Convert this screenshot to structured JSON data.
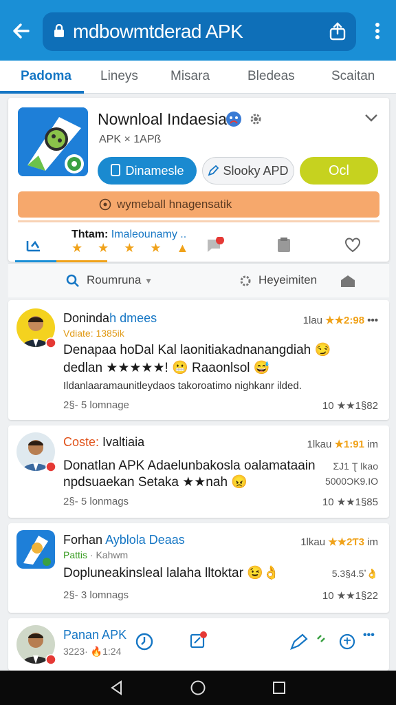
{
  "topbar": {
    "url": "mdbowmtderad APK",
    "colors": {
      "bar": "#1a8fd6",
      "url_box": "#0e6fb8"
    }
  },
  "tabs": [
    {
      "label": "Padoma",
      "active": true
    },
    {
      "label": "Lineys",
      "active": false
    },
    {
      "label": "Misara",
      "active": false
    },
    {
      "label": "Bledeas",
      "active": false
    },
    {
      "label": "Scaitan",
      "active": false
    }
  ],
  "app": {
    "name": "Nownloal Indaesia",
    "subtitle": "APK × 1APß",
    "buttons": {
      "primary": "Dinamesle",
      "outline": "Slooky APD",
      "lime": "Ocl"
    },
    "banner": "wymeball hnagensatik",
    "row_title_bold": "Thtam:",
    "row_title_rest": "Imaleounamy ..",
    "row_stars": "★★★★▲"
  },
  "filter": {
    "left_label": "Roumruna",
    "right_label": "Heyeimiten"
  },
  "reviews": [
    {
      "name_a": "Doninda",
      "name_b": "h dmees",
      "sub": "Vdiate: 1385ik",
      "time": "1lau",
      "score": "★★2:98",
      "line1": "Denapaa hoDal Kal laonitiakadnanangdiah 😏",
      "line2": "dedlan ★★★★★! 😬 Raaonlsol 😅",
      "line3": "Ildanlaaramaunitleydaos takoroatimo nighkanr ilded.",
      "footer": "2§- 5 lomnage",
      "rating": "10 ★★1§82"
    },
    {
      "name_a": "Coste:",
      "name_b": "Ivaltiaia",
      "time": "1lkau",
      "score": "★1:91",
      "score_unit": "im",
      "line1": "Donatlan APK Adaelunbakosla oalamataain",
      "line2": "npdsuaekan Setaka ★★nah 😠",
      "side1": "ƩJ1 Ʈ lkao",
      "side2": "5000ƆK9.IO",
      "footer": "2§- 5 lonmags",
      "rating": "10 ★★1§85"
    },
    {
      "name_a": "Forhan",
      "name_b": "Ayblola Deaas",
      "sub_g": "Pattis",
      "sub_rest": "· Kahwm",
      "time": "1lkau",
      "score": "★★2Ƭ3",
      "score_unit": "im",
      "line1": "Dopluneakinsleal lalaha lltoktar 😉👌",
      "side1": "5.3§4.5ʼ👌",
      "footer": "2§- 3 lomnags",
      "rating": "10 ★★1§22"
    },
    {
      "name": "Panan APK",
      "sub": "3223· 🔥1:24"
    }
  ]
}
